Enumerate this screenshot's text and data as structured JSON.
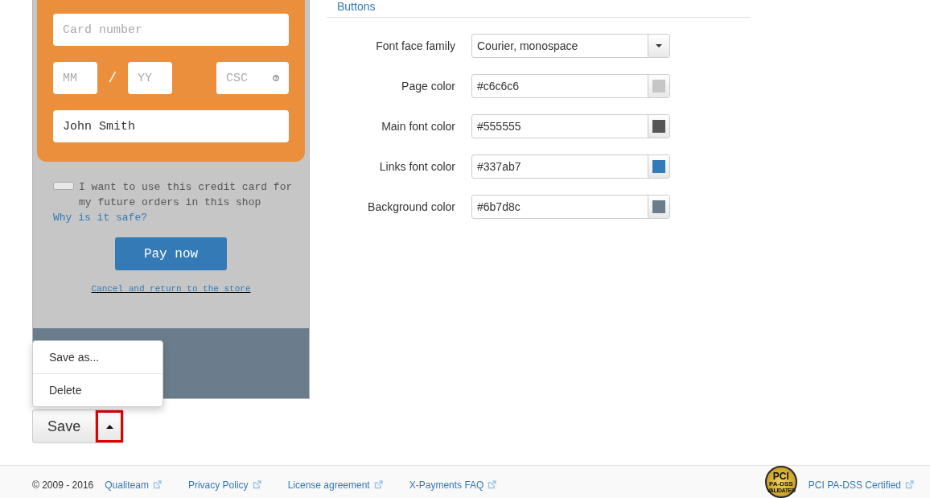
{
  "preview": {
    "card_fields": [
      {
        "kind": "wide",
        "placeholder": "Card number"
      },
      {
        "kind": "short",
        "placeholder": "MM"
      },
      {
        "kind": "separator",
        "text": "/"
      },
      {
        "kind": "short",
        "placeholder": "YY"
      },
      {
        "kind": "csc",
        "placeholder": "CSC"
      },
      {
        "kind": "wide",
        "value": "John Smith"
      }
    ],
    "save_card": {
      "checked": false,
      "label": "I want to use this credit card for my future orders in this shop"
    },
    "why_link": "Why is it safe?",
    "pay_button": "Pay now",
    "cancel_link": "Cancel and return to the store"
  },
  "save_menu": {
    "expanded": true,
    "items": [
      "Save as...",
      "Delete"
    ]
  },
  "save_button": {
    "label": "Save",
    "caret_highlighted": true
  },
  "settings": {
    "section_link": "Buttons",
    "rows": [
      {
        "kind": "select",
        "label": "Font face family",
        "value": "Courier, monospace"
      },
      {
        "kind": "color",
        "label": "Page color",
        "value": "#c6c6c6",
        "color": "#c6c6c6"
      },
      {
        "kind": "color",
        "label": "Main font color",
        "value": "#555555",
        "color": "#555555"
      },
      {
        "kind": "color",
        "label": "Links font color",
        "value": "#337ab7",
        "color": "#337ab7"
      },
      {
        "kind": "color",
        "label": "Background color",
        "value": "#6b7d8c",
        "color": "#6b7d8c"
      }
    ]
  },
  "footer": {
    "copyright": "© 2009 - 2016",
    "links": [
      "Qualiteam",
      "Privacy Policy",
      "License agreement",
      "X-Payments FAQ"
    ],
    "badge_texts": [
      "PCI",
      "PA-DSS",
      "VALIDATED"
    ],
    "certified_link": "PCI PA-DSS Certified"
  }
}
